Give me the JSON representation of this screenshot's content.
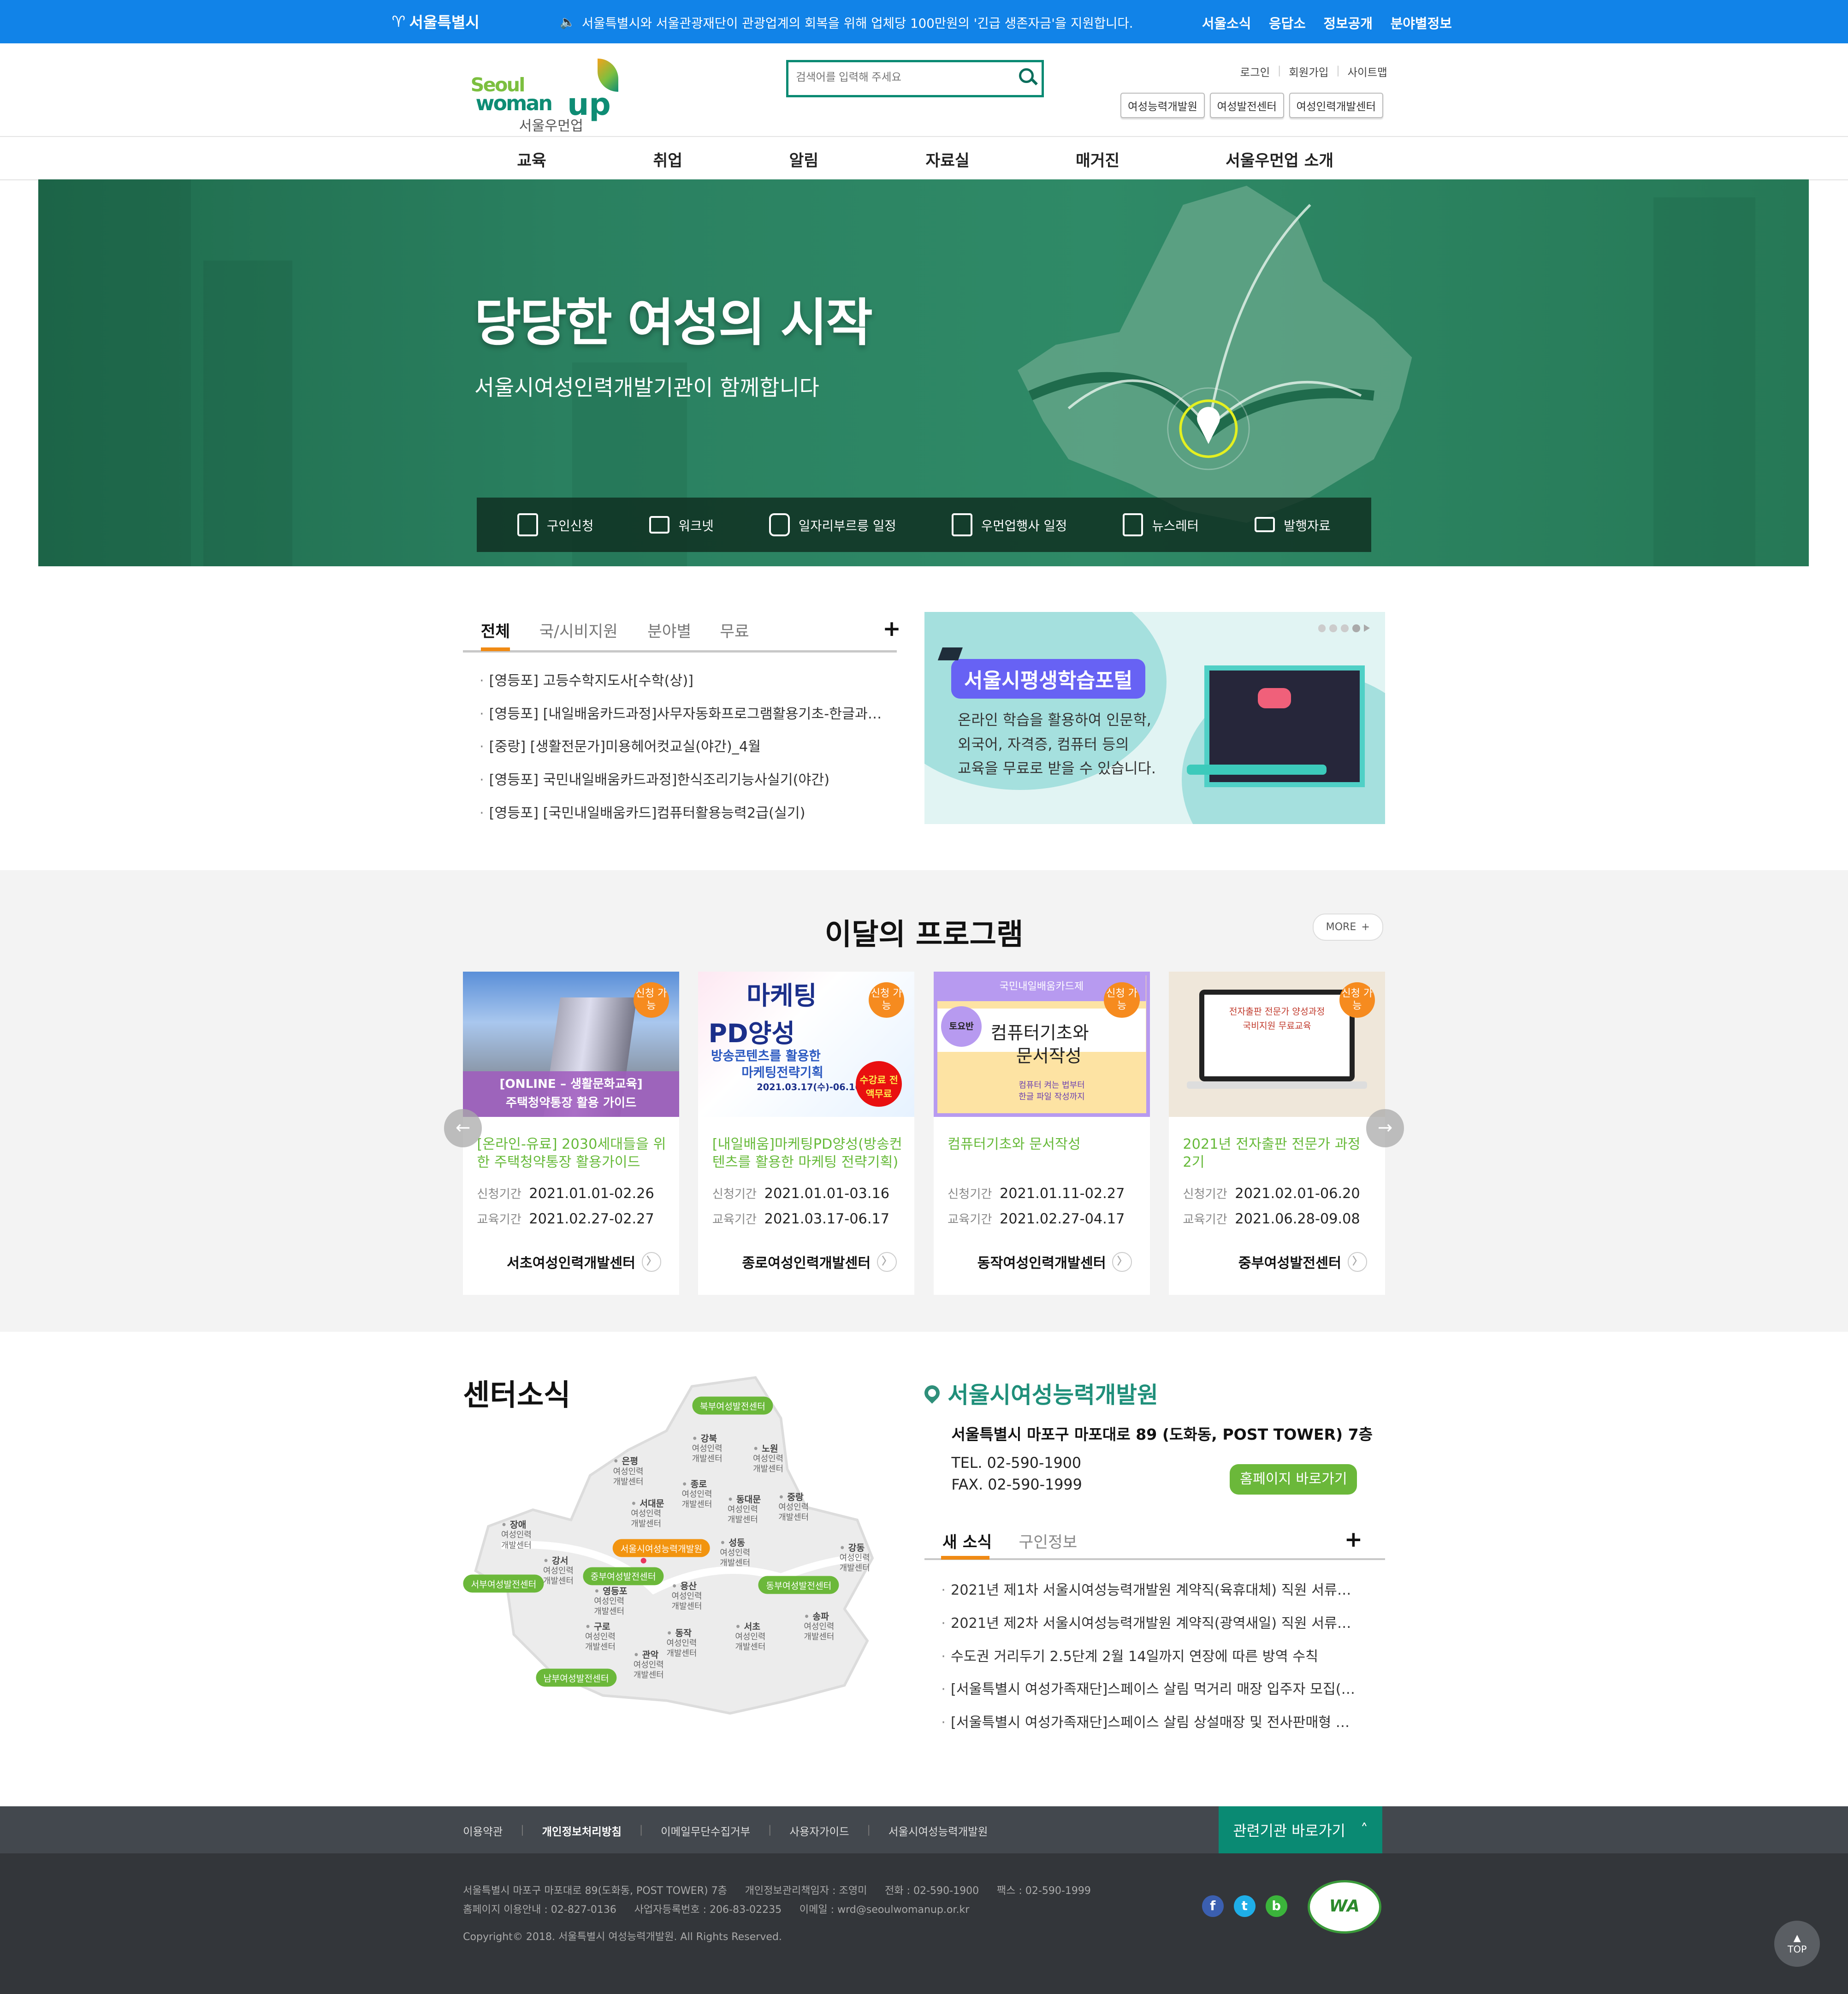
{
  "topbar": {
    "logo": "서울특별시",
    "notice": "서울특별시와 서울관광재단이 관광업계의 회복을 위해 업체당 100만원의 '긴급 생존자금'을 지원합니다.",
    "links": [
      "서울소식",
      "응답소",
      "정보공개",
      "분야별정보"
    ],
    "bg_color": "#1183e8"
  },
  "header": {
    "logo": {
      "en1": "Seoul",
      "en2": "woman",
      "up": "up",
      "ko": "서울우먼업"
    },
    "search_placeholder": "검색어를 입력해 주세요",
    "util_links": [
      "로그인",
      "회원가입",
      "사이트맵"
    ],
    "site_buttons": [
      "여성능력개발원",
      "여성발전센터",
      "여성인력개발센터"
    ]
  },
  "nav": [
    "교육",
    "취업",
    "알림",
    "자료실",
    "매거진",
    "서울우먼업 소개"
  ],
  "hero": {
    "title": "당당한 여성의 시작",
    "subtitle": "서울시여성인력개발기관이 함께합니다",
    "quick_links": [
      {
        "label": "구인신청",
        "icon": "document-icon"
      },
      {
        "label": "워크넷",
        "icon": "folder-icon"
      },
      {
        "label": "일자리부르릉 일정",
        "icon": "bus-icon"
      },
      {
        "label": "우먼업행사 일정",
        "icon": "calendar-icon"
      },
      {
        "label": "뉴스레터",
        "icon": "envelope-icon"
      },
      {
        "label": "발행자료",
        "icon": "publication-icon"
      }
    ]
  },
  "courses": {
    "tabs": [
      "전체",
      "국/시비지원",
      "분야별",
      "무료"
    ],
    "active_tab": "전체",
    "items": [
      "[영등포] 고등수학지도사[수학(상)]",
      "[영등포] [내일배움카드과정]사무자동화프로그램활용기초-한글과…",
      "[중랑] [생활전문가]미용헤어컷교실(야간)_4월",
      "[영등포] 국민내일배움카드과정]한식조리기능사실기(야간)",
      "[영등포] [국민내일배움카드]컴퓨터활용능력2급(실기)"
    ]
  },
  "banner": {
    "title": "서울시평생학습포털",
    "desc": [
      "온라인 학습을 활용하여 인문학,",
      "외국어, 자격증, 컴퓨터 등의",
      "교육을 무료로 받을 수 있습니다."
    ],
    "slides": 5,
    "active_slide": 4
  },
  "programs": {
    "title": "이달의 프로그램",
    "more": "MORE",
    "period_apply_label": "신청기간",
    "period_edu_label": "교육기간",
    "badge": "신청 가능",
    "cards": [
      {
        "image_text": [
          "[ONLINE – 생활문화교육]",
          "주택청약통장 활용 가이드"
        ],
        "title": "[온라인-유료] 2030세대들을 위한 주택청약통장 활용가이드",
        "apply": "2021.01.01-02.26",
        "edu": "2021.02.27-02.27",
        "center": "서초여성인력개발센터"
      },
      {
        "image_text": [
          "마케팅",
          "PD양성",
          "방송콘텐츠를 활용한",
          "마케팅전략기획",
          "2021.03.17(수)-06.16(수)",
          "수강료 전액무료"
        ],
        "title": "[내일배움]마케팅PD양성(방송컨텐츠를 활용한 마케팅 전략기획)",
        "apply": "2021.01.01-03.16",
        "edu": "2021.03.17-06.17",
        "center": "종로여성인력개발센터"
      },
      {
        "image_text": [
          "국민내일배움카드제",
          "토요반",
          "컴퓨터기초와",
          "문서작성",
          "컴퓨터 켜는 법부터",
          "한글 파일 작성까지"
        ],
        "title": "컴퓨터기초와 문서작성",
        "apply": "2021.01.11-02.27",
        "edu": "2021.02.27-04.17",
        "center": "동작여성인력개발센터"
      },
      {
        "image_text": [
          "전자출판 전문가 양성과정",
          "국비지원 무료교육"
        ],
        "title": "2021년 전자출판 전문가 과정 2기",
        "apply": "2021.02.01-06.20",
        "edu": "2021.06.28-09.08",
        "center": "중부여성발전센터"
      }
    ],
    "title_color": "#67ba3a"
  },
  "center_news": {
    "title": "센터소식",
    "map": {
      "sub": [
        "여성인력",
        "개발센터"
      ],
      "districts": [
        "강북",
        "노원",
        "은평",
        "종로",
        "서대문",
        "동대문",
        "중랑",
        "장애",
        "성동",
        "강동",
        "강서",
        "용산",
        "영등포",
        "송파",
        "구로",
        "동작",
        "서초",
        "관악"
      ],
      "pills": [
        "북부여성발전센터",
        "서울시여성능력개발원",
        "중부여성발전센터",
        "서부여성발전센터",
        "동부여성발전센터",
        "남부여성발전센터"
      ]
    },
    "org": {
      "name": "서울시여성능력개발원",
      "address": "서울특별시 마포구 마포대로 89 (도화동, POST TOWER) 7층",
      "tel": "TEL. 02-590-1900",
      "fax": "FAX. 02-590-1999",
      "homepage_button": "홈페이지 바로가기"
    },
    "tabs": [
      "새 소식",
      "구인정보"
    ],
    "active_tab": "새 소식",
    "items": [
      "2021년 제1차 서울시여성능력개발원 계약직(육휴대체) 직원 서류…",
      "2021년 제2차 서울시여성능력개발원 계약직(광역새일) 직원 서류…",
      "수도권 거리두기 2.5단계  2월 14일까지 연장에 따른 방역 수칙",
      "[서울특별시 여성가족재단]스페이스 살림 먹거리 매장 입주자 모집(…",
      "[서울특별시 여성가족재단]스페이스 살림 상설매장 및 전사판매형 …"
    ]
  },
  "footer": {
    "links": [
      "이용약관",
      "개인정보처리방침",
      "이메일무단수집거부",
      "사용자가이드",
      "서울시여성능력개발원"
    ],
    "related_button": "관련기관 바로가기",
    "info_line1": [
      "서울특별시 마포구 마포대로 89(도화동, POST TOWER) 7층",
      "개인정보관리책임자 : 조영미",
      "전화 : 02-590-1900",
      "팩스 : 02-590-1999"
    ],
    "info_line2": [
      "홈페이지 이용안내 : 02-827-0136",
      "사업자등록번호 : 206-83-02235",
      "이메일 : wrd@seoulwomanup.or.kr"
    ],
    "copyright": "Copyright© 2018. 서울특별시 여성능력개발원. All Rights Reserved.",
    "wa_mark": "WA",
    "top_button": "TOP"
  }
}
